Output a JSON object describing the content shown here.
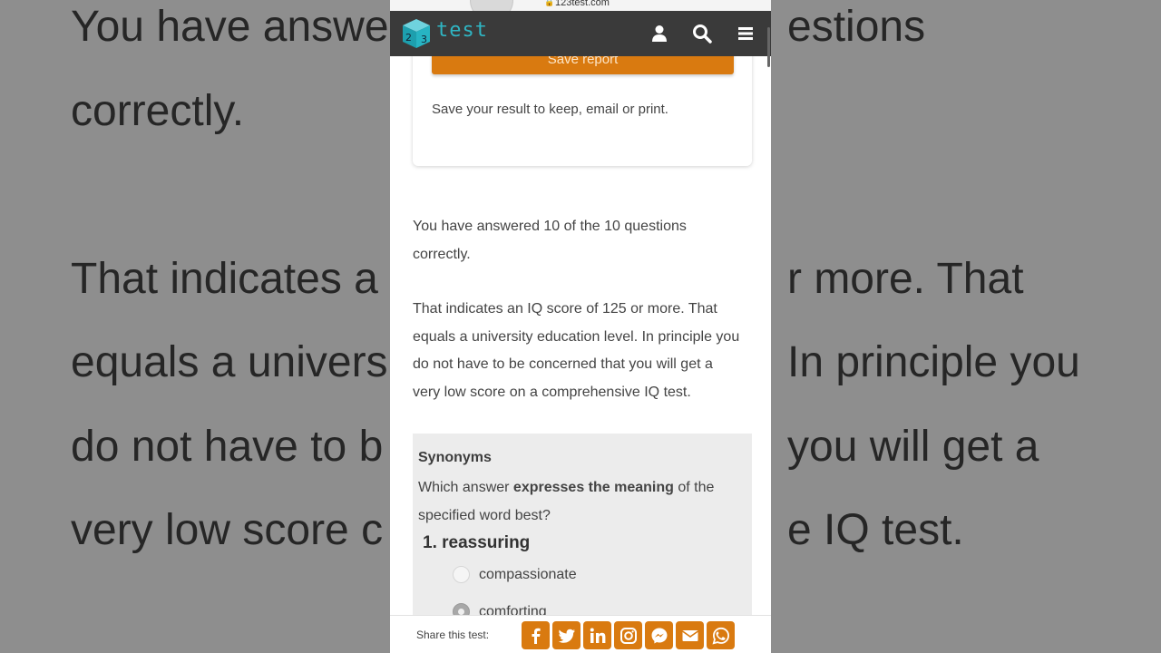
{
  "browser": {
    "url": "123test.com"
  },
  "nav": {
    "logo_text": "test",
    "logo_cube_digits": [
      "2",
      "3"
    ]
  },
  "report_card": {
    "save_label": "Save report",
    "description": "Save your result to keep, email or print."
  },
  "result": {
    "line1": "You have answered 10 of the 10 questions",
    "line2": "correctly.",
    "iq_lines": [
      "That indicates an IQ score of 125 or more. That",
      "equals a university education level. In principle you",
      "do not have to be concerned that you will get a",
      "very low score on a comprehensive IQ test."
    ]
  },
  "background_text": {
    "line1_left": "You have answe",
    "line1_right": "estions",
    "line2": "correctly.",
    "line3_left": "That indicates a",
    "line3_right": "r more. That",
    "line4_left": "equals a univers",
    "line4_right": "In principle you",
    "line5_left": "do not have to b",
    "line5_right": "you will get a",
    "line6_left": "very low score c",
    "line6_right": "e IQ test."
  },
  "quiz": {
    "section_title": "Synonyms",
    "instruction_pre": "Which answer ",
    "instruction_bold": "expresses the meaning",
    "instruction_post": " of the",
    "instruction_line2": "specified word best?",
    "question": "1. reassuring",
    "options": [
      {
        "label": "compassionate",
        "selected": false
      },
      {
        "label": "comforting",
        "selected": true
      }
    ]
  },
  "share": {
    "label": "Share this test:",
    "icons": [
      "facebook-icon",
      "twitter-icon",
      "linkedin-icon",
      "instagram-icon",
      "messenger-icon",
      "email-icon",
      "whatsapp-icon"
    ]
  },
  "colors": {
    "accent": "#d97a10",
    "nav_bg": "#3a3a3a",
    "logo": "#2fb5c3",
    "quiz_bg": "#ececec"
  }
}
